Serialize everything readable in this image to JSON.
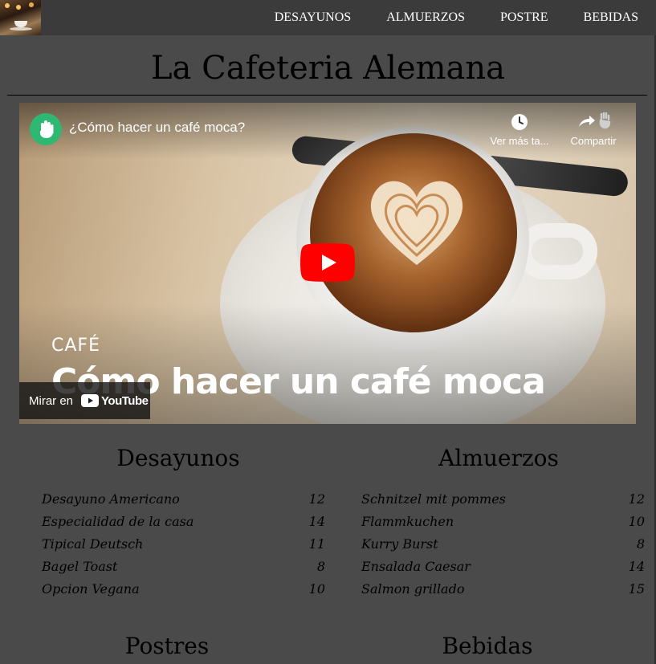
{
  "nav": {
    "logo_alt": "logo",
    "links": [
      "DESAYUNOS",
      "ALMUERZOS",
      "POSTRE",
      "BEBIDAS"
    ]
  },
  "header": {
    "title": "La Cafeteria Alemana"
  },
  "video": {
    "title": "¿Cómo hacer un café moca?",
    "watch_later": "Ver más ta...",
    "share": "Compartir",
    "category": "CAFÉ",
    "caption": "Cómo hacer un café moca",
    "watch_on": "Mirar en",
    "youtube": "YouTube",
    "colors": {
      "play": "#ff0000",
      "avatar": "#2eb872"
    }
  },
  "menus": {
    "desayunos": {
      "title": "Desayunos",
      "items": [
        {
          "name": "Desayuno Americano",
          "price": "12"
        },
        {
          "name": "Especialidad de la casa",
          "price": "14"
        },
        {
          "name": "Tipical Deutsch",
          "price": "11"
        },
        {
          "name": "Bagel Toast",
          "price": "8"
        },
        {
          "name": "Opcion Vegana",
          "price": "10"
        }
      ]
    },
    "almuerzos": {
      "title": "Almuerzos",
      "items": [
        {
          "name": "Schnitzel mit pommes",
          "price": "12"
        },
        {
          "name": "Flammkuchen",
          "price": "10"
        },
        {
          "name": "Kurry Burst",
          "price": "8"
        },
        {
          "name": "Ensalada Caesar",
          "price": "14"
        },
        {
          "name": "Salmon grillado",
          "price": "15"
        }
      ]
    },
    "postres": {
      "title": "Postres"
    },
    "bebidas": {
      "title": "Bebidas"
    }
  }
}
